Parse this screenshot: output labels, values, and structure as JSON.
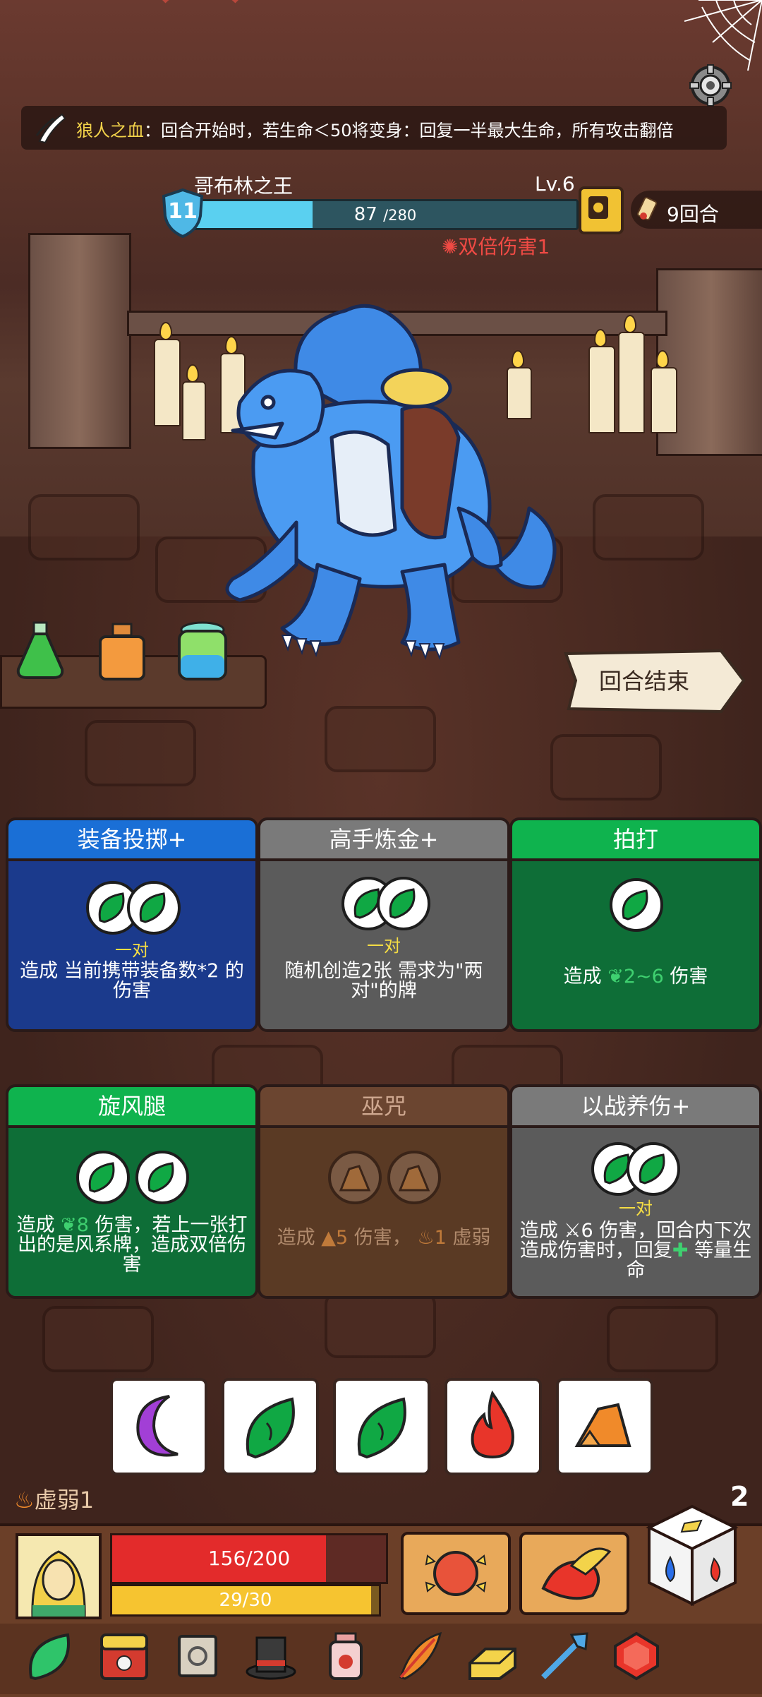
{
  "buff": {
    "name": "狼人之血",
    "separator": "：",
    "text": "回合开始时，若生命＜50将变身：回复一半最大生命，所有攻击翻倍"
  },
  "enemy": {
    "name": "哥布林之王",
    "level": "Lv.6",
    "hp": "87",
    "hp_max": "/280",
    "hp_fraction": 0.31,
    "shield": "11",
    "status": "双倍伤害1"
  },
  "turn": {
    "label": "9回合"
  },
  "end_turn": {
    "label": "回合结束"
  },
  "cards": [
    {
      "title": "装备投掷+",
      "pair": "一对",
      "desc": "造成 当前携带装备数*2 的伤害",
      "color": "blue"
    },
    {
      "title": "高手炼金+",
      "pair": "一对",
      "desc": "随机创造2张 需求为\"两对\"的牌",
      "color": "gray"
    },
    {
      "title": "拍打",
      "pair": "",
      "desc_pre": "造成 ",
      "desc_val": "2~6",
      "desc_post": " 伤害",
      "color": "green"
    },
    {
      "title": "旋风腿",
      "pair": "",
      "desc_pre": "造成 ",
      "desc_val": "8",
      "desc_post": " 伤害，若上一张打出的是风系牌，造成双倍伤害",
      "color": "green"
    },
    {
      "title": "巫咒",
      "pair": "",
      "desc_pre": "造成 ",
      "desc_val": "5",
      "desc_mid": " 伤害， ",
      "desc_val2": "1",
      "desc_post": " 虚弱",
      "color": "brown"
    },
    {
      "title": "以战养伤+",
      "pair": "一对",
      "desc_pre": "造成 ",
      "desc_val": "6",
      "desc_post": " 伤害，回合内下次造成伤害时，回复",
      "desc_tail": " 等量生命",
      "color": "gray"
    }
  ],
  "dice": [
    "moon-icon",
    "leaf-icon",
    "leaf-icon",
    "fire-icon",
    "rock-icon"
  ],
  "player": {
    "weak": "虚弱1",
    "hp": "156/200",
    "hp_fraction": 0.78,
    "energy": "29/30",
    "energy_fraction": 0.97,
    "dice_count": "2"
  },
  "colors": {
    "hp_red": "#e32b2b",
    "energy_yellow": "#f6c430",
    "enemy_hp": "#5ad0f0",
    "card_green": "#0fb34e",
    "card_blue": "#1a6fd6"
  }
}
